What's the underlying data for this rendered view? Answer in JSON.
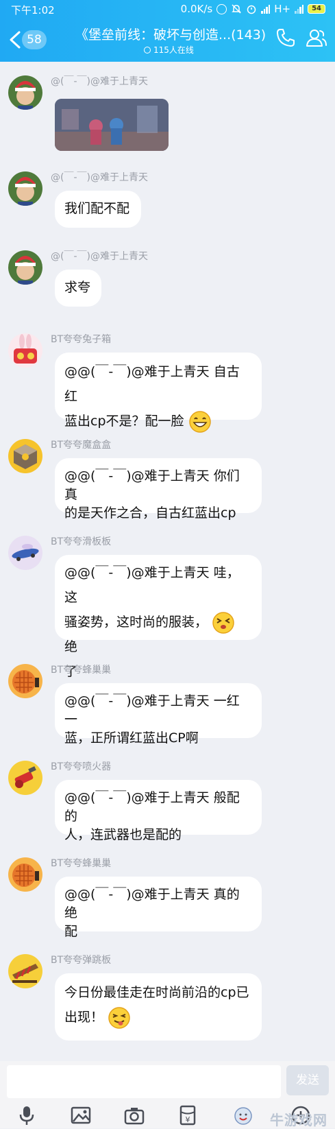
{
  "status_bar": {
    "time": "下午1:02",
    "net_speed": "0.0K/s",
    "network": "H+",
    "battery": "54"
  },
  "header": {
    "unread_count": "58",
    "title": "《堡垒前线：破坏与创造...(143)",
    "online": "115人在线"
  },
  "messages": [
    {
      "nick": "@(￣-￣)@难于上青天",
      "type": "image",
      "avatar": "boy-avatar"
    },
    {
      "nick": "@(￣-￣)@难于上青天",
      "text_lines": [
        "我们配不配"
      ],
      "avatar": "boy-avatar"
    },
    {
      "nick": "@(￣-￣)@难于上青天",
      "text_lines": [
        "求夸"
      ],
      "avatar": "boy-avatar"
    },
    {
      "nick": "BT夸夸兔子箱",
      "text_lines": [
        "@@(￣-￣)@难于上青天 自古红",
        "蓝出cp不是？配一脸"
      ],
      "emoji": "grin-face",
      "avatar": "rabbit-box-avatar"
    },
    {
      "nick": "BT夸夸魔盒盒",
      "text_lines": [
        "@@(￣-￣)@难于上青天 你们真",
        "的是天作之合，自古红蓝出cp"
      ],
      "avatar": "magic-box-avatar"
    },
    {
      "nick": "BT夸夸滑板板",
      "text_lines": [
        "@@(￣-￣)@难于上青天 哇，这",
        "骚姿势，这时尚的服装，",
        "绝",
        "了"
      ],
      "emoji": "squint-face",
      "avatar": "skateboard-avatar"
    },
    {
      "nick": "BT夸夸蜂巢巢",
      "text_lines": [
        "@@(￣-￣)@难于上青天 一红一",
        "蓝，正所谓红蓝出CP啊"
      ],
      "avatar": "hive-avatar"
    },
    {
      "nick": "BT夸夸喷火器",
      "text_lines": [
        "@@(￣-￣)@难于上青天 般配的",
        "人，连武器也是配的"
      ],
      "avatar": "flamethrower-avatar"
    },
    {
      "nick": "BT夸夸蜂巢巢",
      "text_lines": [
        "@@(￣-￣)@难于上青天 真的绝",
        "配"
      ],
      "avatar": "hive-avatar"
    },
    {
      "nick": "BT夸夸弹跳板",
      "text_lines": [
        "今日份最佳走在时尚前沿的cp已",
        "出现！"
      ],
      "emoji": "tongue-face",
      "avatar": "springboard-avatar"
    }
  ],
  "input": {
    "placeholder": "",
    "send_label": "发送"
  },
  "toolbar_icons": [
    "microphone-icon",
    "image-icon",
    "camera-icon",
    "red-packet-icon",
    "emoji-icon",
    "plus-icon"
  ],
  "watermark": "牛游戏网",
  "colors": {
    "header": "#20a9f3",
    "background": "#eef0f5",
    "nickname": "#9a9ea7"
  }
}
